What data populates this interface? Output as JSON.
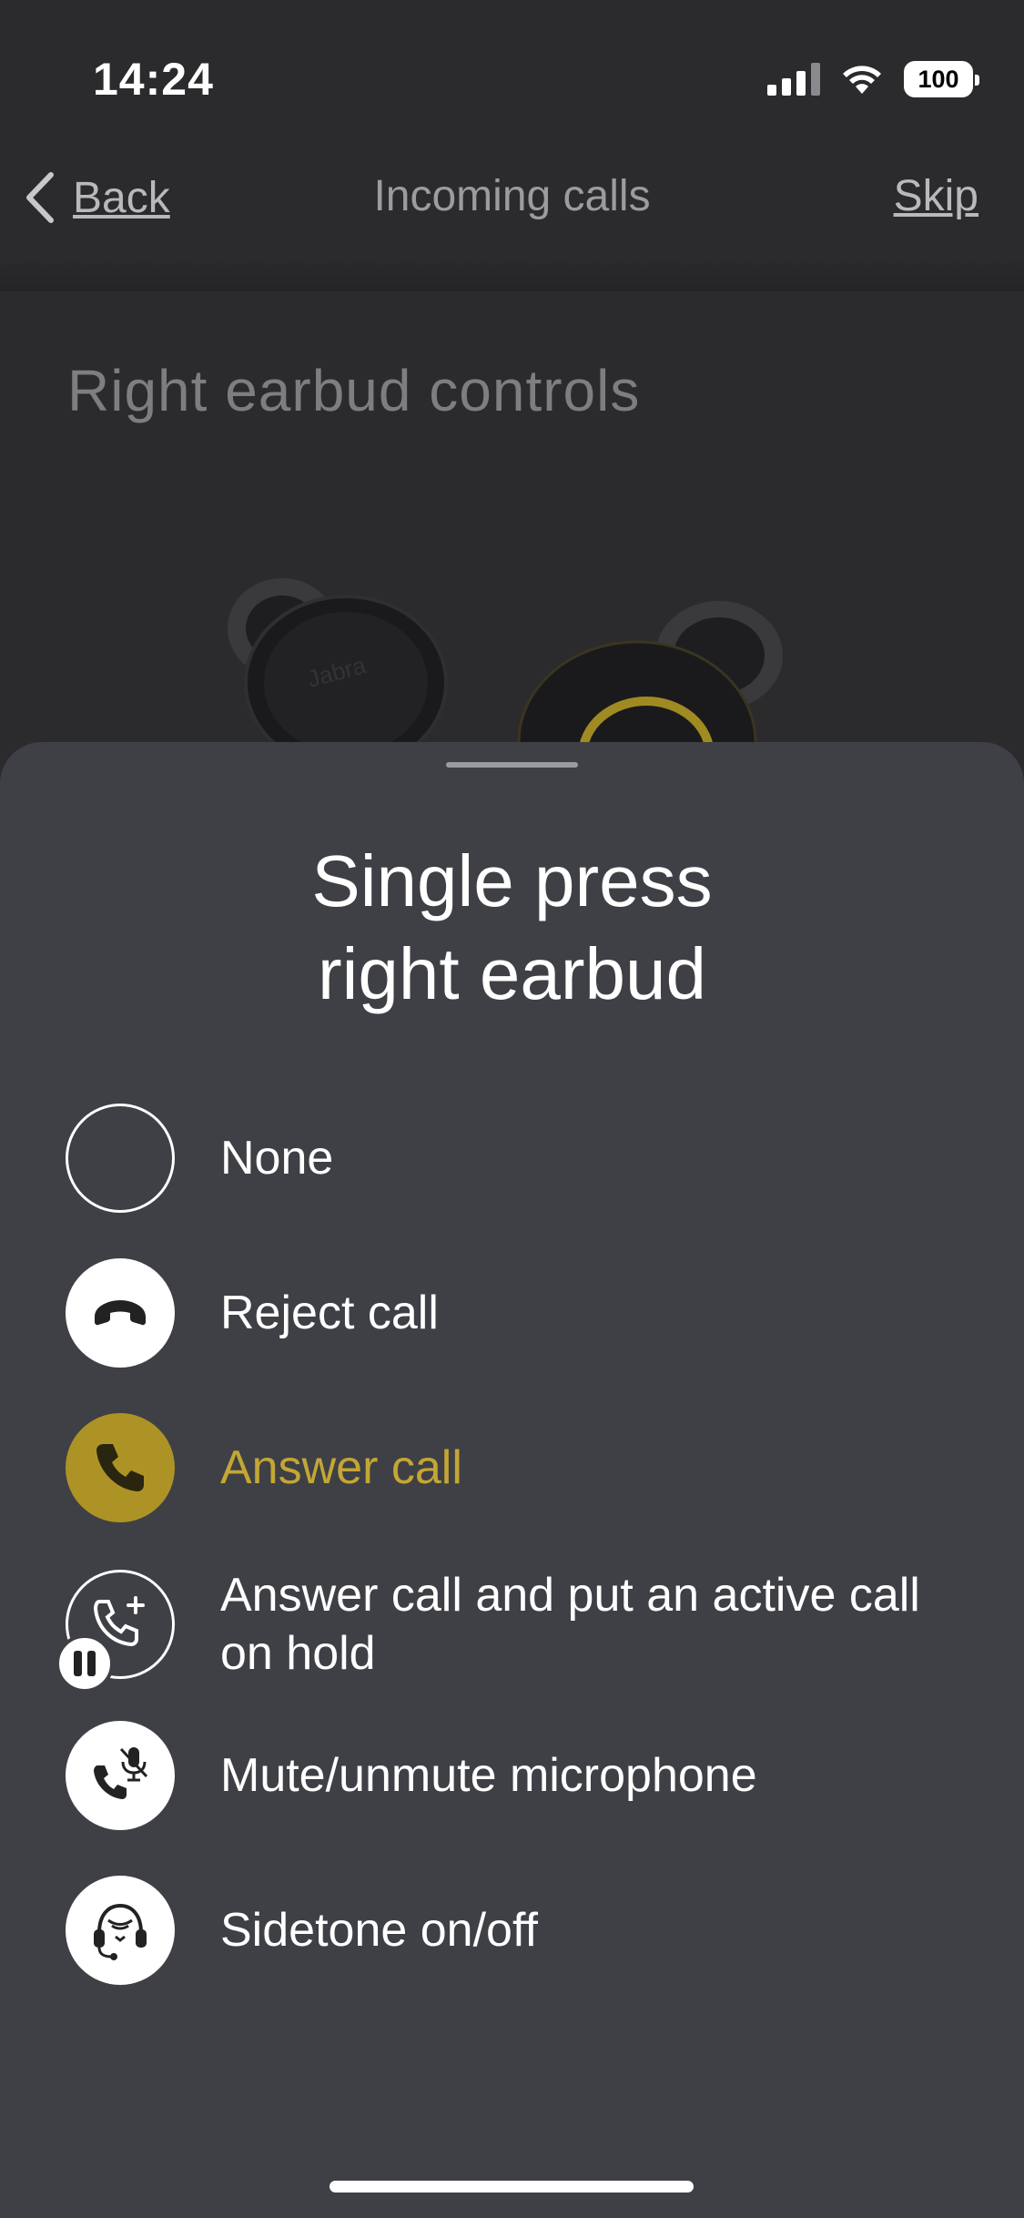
{
  "status_bar": {
    "time": "14:24",
    "battery": "100"
  },
  "nav": {
    "back_label": "Back",
    "title": "Incoming calls",
    "skip_label": "Skip"
  },
  "background": {
    "section_title": "Right earbud controls",
    "earbud_brand": "Jabra"
  },
  "sheet": {
    "title_line1": "Single press",
    "title_line2": "right earbud",
    "options": [
      {
        "label": "None",
        "icon": "empty-circle-icon",
        "selected": false
      },
      {
        "label": "Reject call",
        "icon": "hang-up-phone-icon",
        "selected": false
      },
      {
        "label": "Answer call",
        "icon": "phone-icon",
        "selected": true
      },
      {
        "label": "Answer call and put an active call on hold",
        "icon": "phone-add-hold-icon",
        "selected": false
      },
      {
        "label": "Mute/unmute microphone",
        "icon": "phone-mic-icon",
        "selected": false
      },
      {
        "label": "Sidetone on/off",
        "icon": "headset-sidetone-icon",
        "selected": false
      }
    ]
  },
  "colors": {
    "accent": "#c4a634",
    "accent_fill": "#ad9325",
    "sheet_bg": "#3f4045"
  }
}
